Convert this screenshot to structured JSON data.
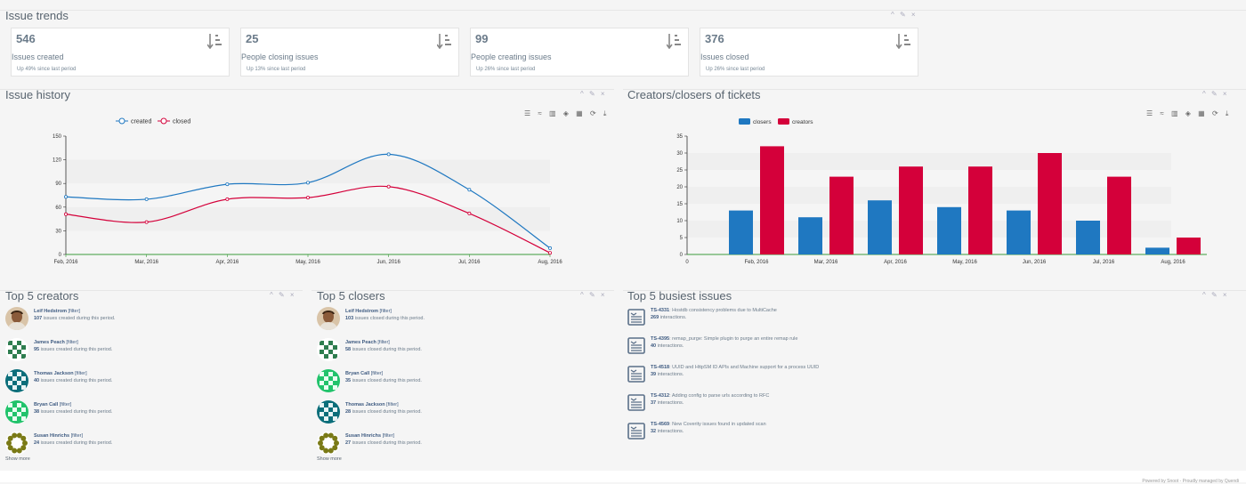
{
  "trends": {
    "title": "Issue trends",
    "cards": [
      {
        "value": "546",
        "label": "Issues created",
        "sub": "Up 49% since last period"
      },
      {
        "value": "25",
        "label": "People closing issues",
        "sub": "Up 13% since last period"
      },
      {
        "value": "99",
        "label": "People creating issues",
        "sub": "Up 26% since last period"
      },
      {
        "value": "376",
        "label": "Issues closed",
        "sub": "Up 26% since last period"
      }
    ]
  },
  "widget_controls": "^ ✎ ×",
  "history": {
    "title": "Issue history",
    "tools": "☰ ≈ ▥ ◈ ▦ ⟳ ⤓"
  },
  "creators_closers": {
    "title": "Creators/closers of tickets",
    "tools": "☰ ≈ ▥ ◈ ▦ ⟳ ⤓"
  },
  "chart_data": [
    {
      "type": "line",
      "x": [
        "Feb, 2016",
        "Mar, 2016",
        "Apr, 2016",
        "May, 2016",
        "Jun, 2016",
        "Jul, 2016",
        "Aug, 2016"
      ],
      "series": [
        {
          "name": "created",
          "values": [
            73,
            70,
            89,
            91,
            127,
            82,
            8
          ],
          "color": "#1f78c1"
        },
        {
          "name": "closed",
          "values": [
            51,
            41,
            70,
            72,
            86,
            52,
            2
          ],
          "color": "#d4003a"
        }
      ],
      "ylim": [
        0,
        150
      ],
      "yticks": [
        "0",
        "30",
        "60",
        "90",
        "120",
        "150"
      ],
      "legend": "top-center"
    },
    {
      "type": "bar",
      "categories": [
        "Feb, 2016",
        "Mar, 2016",
        "Apr, 2016",
        "May, 2016",
        "Jun, 2016",
        "Jul, 2016",
        "Aug, 2016"
      ],
      "series": [
        {
          "name": "closers",
          "values": [
            13,
            11,
            16,
            14,
            13,
            10,
            2
          ],
          "color": "#1f78c1"
        },
        {
          "name": "creators",
          "values": [
            32,
            23,
            26,
            26,
            30,
            23,
            5
          ],
          "color": "#d4003a"
        }
      ],
      "ylim": [
        0,
        35
      ],
      "yticks": [
        "0",
        "5",
        "10",
        "15",
        "20",
        "25",
        "30",
        "35"
      ],
      "xstart_label": "0",
      "legend": "top-center"
    }
  ],
  "top_creators": {
    "title": "Top 5 creators",
    "filter_label": "[filter]",
    "desc": "issues created during this period.",
    "people": [
      {
        "name": "Leif Hedstrom",
        "count": "107"
      },
      {
        "name": "James Peach",
        "count": "95"
      },
      {
        "name": "Thomas Jackson",
        "count": "40"
      },
      {
        "name": "Bryan Call",
        "count": "38"
      },
      {
        "name": "Susan Hinrichs",
        "count": "24"
      }
    ],
    "show_more": "Show more"
  },
  "top_closers": {
    "title": "Top 5 closers",
    "filter_label": "[filter]",
    "desc": "issues closed during this period.",
    "people": [
      {
        "name": "Leif Hedstrom",
        "count": "103"
      },
      {
        "name": "James Peach",
        "count": "58"
      },
      {
        "name": "Bryan Call",
        "count": "35"
      },
      {
        "name": "Thomas Jackson",
        "count": "28"
      },
      {
        "name": "Susan Hinrichs",
        "count": "27"
      }
    ],
    "show_more": "Show more"
  },
  "busiest": {
    "title": "Top 5 busiest issues",
    "interactions_label": "interactions.",
    "issues": [
      {
        "key": "TS-4331",
        "summary": ": Hostdb consistency problems due to MultiCache",
        "count": "269"
      },
      {
        "key": "TS-4395",
        "summary": ": remap_purge: Simple plugin to purge an entire remap rule",
        "count": "40"
      },
      {
        "key": "TS-4518",
        "summary": ": UUID and HttpSM ID APIs and Machine support for a process UUID",
        "count": "39"
      },
      {
        "key": "TS-4312",
        "summary": ": Adding config to parse urls according to RFC",
        "count": "37"
      },
      {
        "key": "TS-4569",
        "summary": ": New Coverity issues found in updated scan",
        "count": "32"
      }
    ]
  },
  "footer": "Powered by Snoot - Proudly managed by Quendi"
}
